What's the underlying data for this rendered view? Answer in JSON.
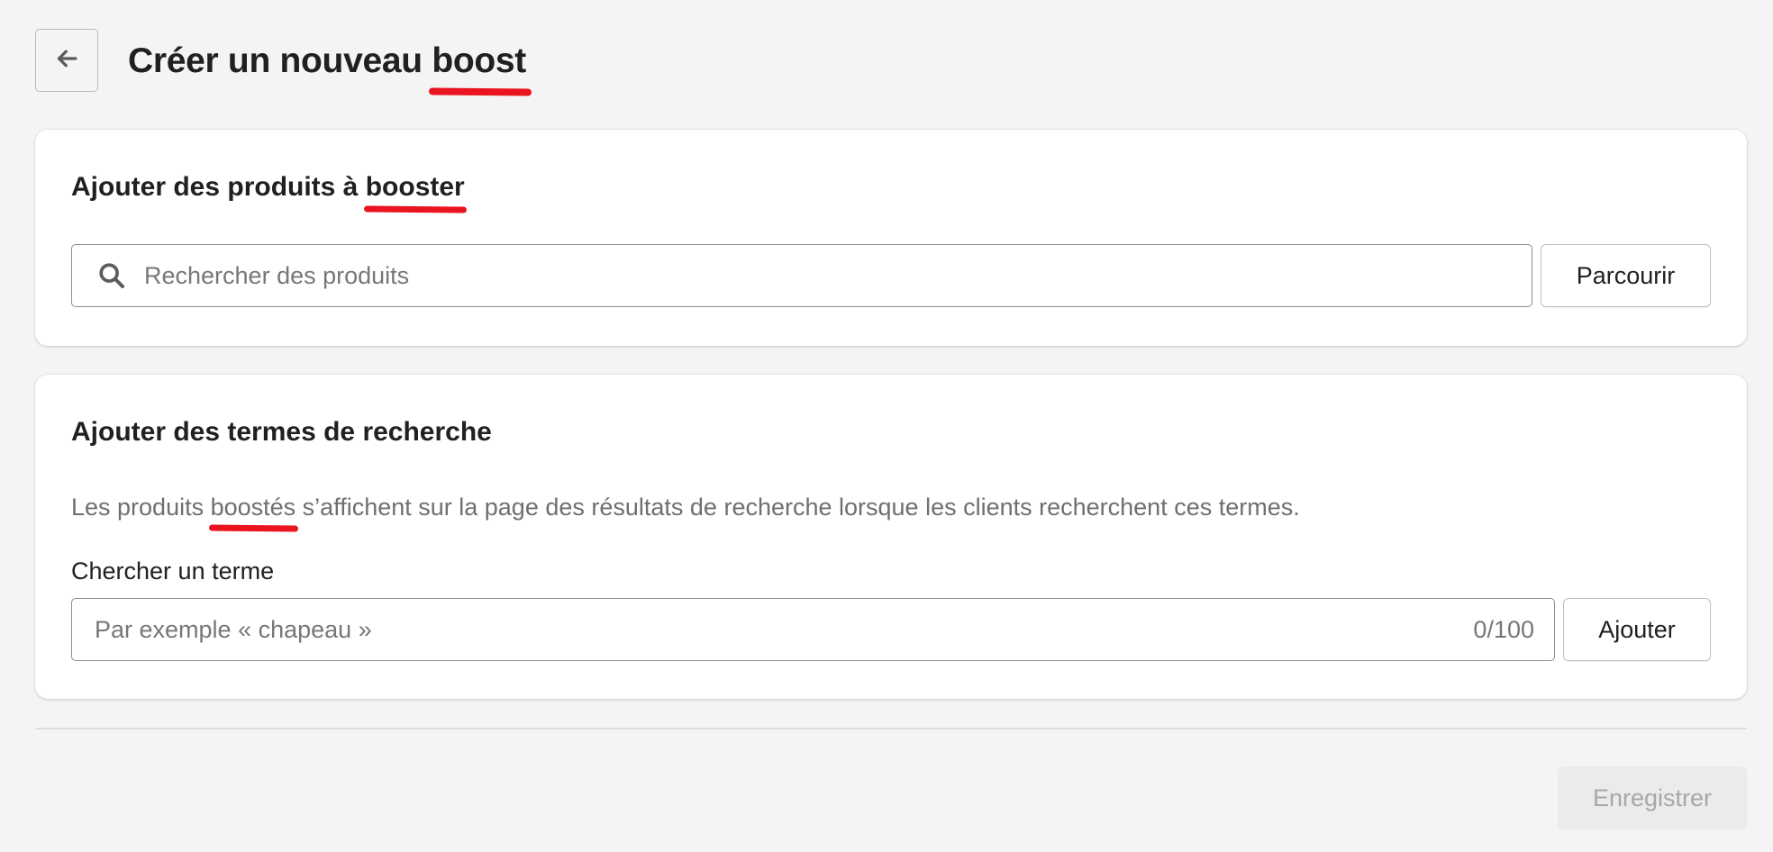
{
  "header": {
    "back_button_label": "",
    "title_prefix": "Créer un nouveau ",
    "title_highlight": "boost"
  },
  "products_card": {
    "title_prefix": "Ajouter des produits à ",
    "title_highlight": "booster",
    "search_placeholder": "Rechercher des produits",
    "search_value": "",
    "browse_label": "Parcourir"
  },
  "terms_card": {
    "title": "Ajouter des termes de recherche",
    "help_prefix": "Les produits ",
    "help_highlight": "boostés",
    "help_suffix": " s’affichent sur la page des résultats de recherche lorsque les clients recherchent ces termes.",
    "field_label": "Chercher un terme",
    "term_placeholder": "Par exemple « chapeau »",
    "term_value": "",
    "char_count": "0/100",
    "add_label": "Ajouter"
  },
  "footer": {
    "save_label": "Enregistrer",
    "save_disabled": true
  },
  "colors": {
    "annotation_underline": "#ea1420",
    "background": "#f4f4f4",
    "card": "#ffffff",
    "disabled_button": "#ebebeb"
  },
  "icons": {
    "back": "arrow-left-icon",
    "search": "search-icon"
  }
}
